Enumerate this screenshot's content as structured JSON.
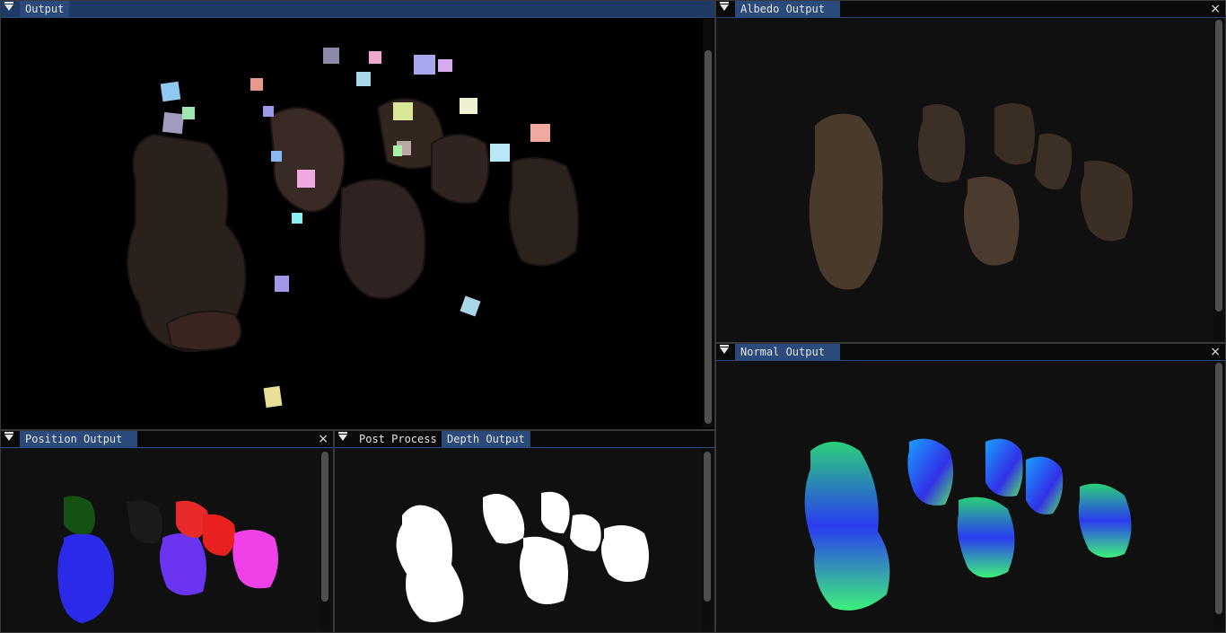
{
  "panels": {
    "output": {
      "title": "Output"
    },
    "albedo": {
      "title": "Albedo Output",
      "close": "×"
    },
    "normal": {
      "title": "Normal Output",
      "close": "×"
    },
    "position": {
      "title": "Position Output",
      "close": "×"
    },
    "bottom_center": {
      "tabs": [
        "Post Process",
        "Depth Output"
      ],
      "active_tab": "Depth Output"
    }
  },
  "colors": {
    "background": "#0f0f0f",
    "title_active": "#203a66",
    "tab_selected": "#294a7a",
    "border": "#3a3a3a"
  }
}
